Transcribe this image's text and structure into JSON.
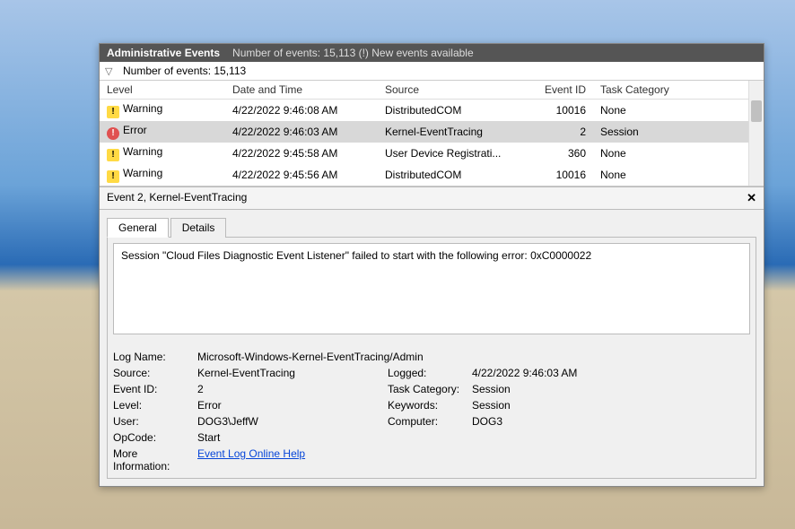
{
  "header": {
    "title": "Administrative Events",
    "subtitle": "Number of events: 15,113 (!) New events available"
  },
  "countBar": {
    "text": "Number of events: 15,113"
  },
  "columns": {
    "level": "Level",
    "date": "Date and Time",
    "source": "Source",
    "eventId": "Event ID",
    "taskCategory": "Task Category"
  },
  "events": [
    {
      "level": "Warning",
      "icon": "warning",
      "date": "4/22/2022 9:46:08 AM",
      "source": "DistributedCOM",
      "id": "10016",
      "task": "None",
      "selected": false
    },
    {
      "level": "Error",
      "icon": "error",
      "date": "4/22/2022 9:46:03 AM",
      "source": "Kernel-EventTracing",
      "id": "2",
      "task": "Session",
      "selected": true
    },
    {
      "level": "Warning",
      "icon": "warning",
      "date": "4/22/2022 9:45:58 AM",
      "source": "User Device Registrati...",
      "id": "360",
      "task": "None",
      "selected": false
    },
    {
      "level": "Warning",
      "icon": "warning",
      "date": "4/22/2022 9:45:56 AM",
      "source": "DistributedCOM",
      "id": "10016",
      "task": "None",
      "selected": false
    }
  ],
  "detail": {
    "title": "Event 2, Kernel-EventTracing",
    "tabs": {
      "general": "General",
      "details": "Details"
    },
    "message": "Session \"Cloud Files Diagnostic Event Listener\" failed to start with the following error: 0xC0000022",
    "labels": {
      "logName": "Log Name:",
      "source": "Source:",
      "eventId": "Event ID:",
      "level": "Level:",
      "user": "User:",
      "opcode": "OpCode:",
      "moreInfo": "More Information:",
      "logged": "Logged:",
      "taskCategory": "Task Category:",
      "keywords": "Keywords:",
      "computer": "Computer:"
    },
    "values": {
      "logName": "Microsoft-Windows-Kernel-EventTracing/Admin",
      "source": "Kernel-EventTracing",
      "eventId": "2",
      "level": "Error",
      "user": "DOG3\\JeffW",
      "opcode": "Start",
      "moreInfo": "Event Log Online Help",
      "logged": "4/22/2022 9:46:03 AM",
      "taskCategory": "Session",
      "keywords": "Session",
      "computer": "DOG3"
    }
  }
}
